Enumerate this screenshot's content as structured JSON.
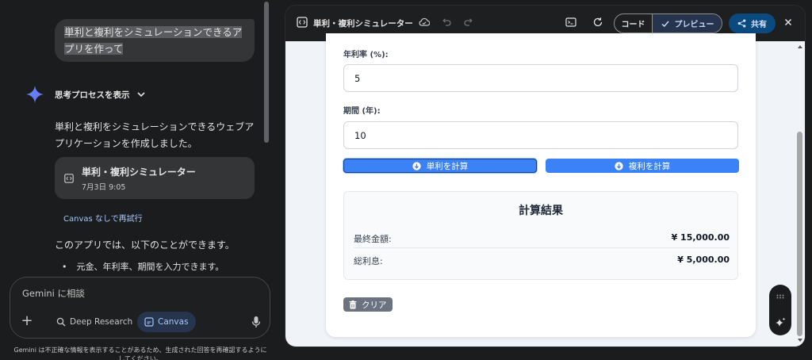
{
  "chat": {
    "user_prompt": "単利と複利をシミュレーションできるアプリを作って",
    "think_label": "思考プロセスを表示",
    "reply": "単利と複利をシミュレーションできるウェブアプリケーションを作成しました。",
    "app_card": {
      "title": "単利・複利シミュレーター",
      "date": "7月3日 9:05"
    },
    "retry_link": "Canvas なしで再試行",
    "feature_intro": "このアプリでは、以下のことができます。",
    "bullet_1": "元金、年利率、期間を入力できます。",
    "composer": {
      "placeholder": "Gemini に相談",
      "deep_research": "Deep Research",
      "canvas": "Canvas"
    },
    "disclaimer": "Gemini は不正確な情報を表示することがあるため、生成された回答を再確認するようにしてください。"
  },
  "canvas": {
    "title": "単利・複利シミュレーター",
    "code_label": "コード",
    "preview_label": "プレビュー",
    "share_label": "共有"
  },
  "app": {
    "rate_label": "年利率 (%):",
    "rate_value": "5",
    "period_label": "期間 (年):",
    "period_value": "10",
    "simple_button": "単利を計算",
    "compound_button": "複利を計算",
    "result_title": "計算結果",
    "final_label": "最終金額:",
    "final_value": "¥ 15,000.00",
    "interest_label": "総利息:",
    "interest_value": "¥ 5,000.00",
    "clear_button": "クリア"
  }
}
